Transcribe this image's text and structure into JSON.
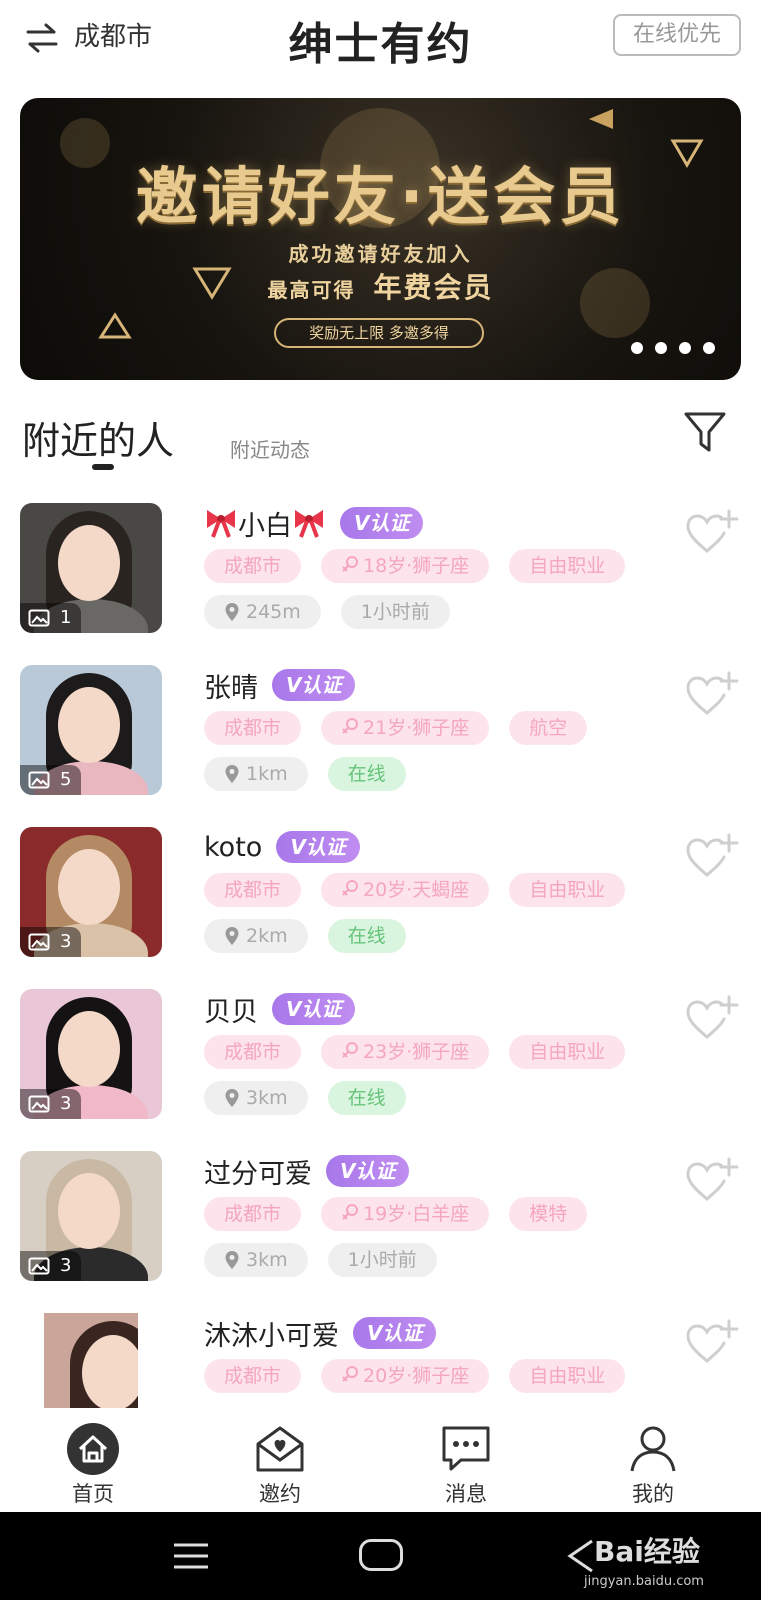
{
  "header": {
    "city": "成都市",
    "title": "绅士有约",
    "online_first": "在线优先"
  },
  "banner": {
    "headline": "邀请好友·送会员",
    "subline": "成功邀请好友加入",
    "offer_prefix": "最高可得",
    "offer_highlight": "年费会员",
    "pill": "奖励无上限 多邀多得",
    "page_count": 4
  },
  "tabs": {
    "active": "附近的人",
    "secondary": "附近动态"
  },
  "users": [
    {
      "name": "小白",
      "bow": true,
      "verified": "V认证",
      "photos": "1",
      "tags": [
        "成都市",
        "18岁·狮子座",
        "自由职业"
      ],
      "distance": "245m",
      "status": "1小时前",
      "status_type": "time",
      "avatar_colors": {
        "bg": "#4a4845",
        "hair": "#2a2420",
        "clothes": "#6a6865"
      }
    },
    {
      "name": "张晴",
      "bow": false,
      "verified": "V认证",
      "photos": "5",
      "tags": [
        "成都市",
        "21岁·狮子座",
        "航空"
      ],
      "distance": "1km",
      "status": "在线",
      "status_type": "online",
      "avatar_colors": {
        "bg": "#b9c9d8",
        "hair": "#1d1a1c",
        "clothes": "#e8b7c0"
      }
    },
    {
      "name": "koto",
      "bow": false,
      "verified": "V认证",
      "photos": "3",
      "tags": [
        "成都市",
        "20岁·天蝎座",
        "自由职业"
      ],
      "distance": "2km",
      "status": "在线",
      "status_type": "online",
      "avatar_colors": {
        "bg": "#8a2a2a",
        "hair": "#b38a64",
        "clothes": "#d9c2a8"
      }
    },
    {
      "name": "贝贝",
      "bow": false,
      "verified": "V认证",
      "photos": "3",
      "tags": [
        "成都市",
        "23岁·狮子座",
        "自由职业"
      ],
      "distance": "3km",
      "status": "在线",
      "status_type": "online",
      "avatar_colors": {
        "bg": "#e9c7d6",
        "hair": "#151214",
        "clothes": "#f0b8c8"
      }
    },
    {
      "name": "过分可爱",
      "bow": false,
      "verified": "V认证",
      "photos": "3",
      "tags": [
        "成都市",
        "19岁·白羊座",
        "模特"
      ],
      "distance": "3km",
      "status": "1小时前",
      "status_type": "time",
      "avatar_colors": {
        "bg": "#d7cfc3",
        "hair": "#c9b8a3",
        "clothes": "#2b2b2b"
      }
    },
    {
      "name": "沐沐小可爱",
      "bow": false,
      "verified": "V认证",
      "photos": "",
      "tags": [
        "成都市",
        "20岁·狮子座",
        "自由职业"
      ],
      "distance": "",
      "status": "",
      "status_type": "",
      "avatar_colors": {
        "bg": "#caa59a",
        "hair": "#3a2620",
        "clothes": "#7a5044"
      }
    }
  ],
  "tabbar": [
    {
      "label": "首页",
      "icon": "home-icon",
      "active": true
    },
    {
      "label": "邀约",
      "icon": "invite-envelope-icon",
      "active": false
    },
    {
      "label": "消息",
      "icon": "message-bubble-icon",
      "active": false
    },
    {
      "label": "我的",
      "icon": "profile-person-icon",
      "active": false
    }
  ],
  "watermark": {
    "brand": "Bai经验",
    "url": "jingyan.baidu.com"
  },
  "colors": {
    "verified": "#b482ee",
    "pink_tag_bg": "#fde3ec",
    "pink_tag_text": "#f4a6bf",
    "online_bg": "#daf5df",
    "online_text": "#66c47a"
  }
}
